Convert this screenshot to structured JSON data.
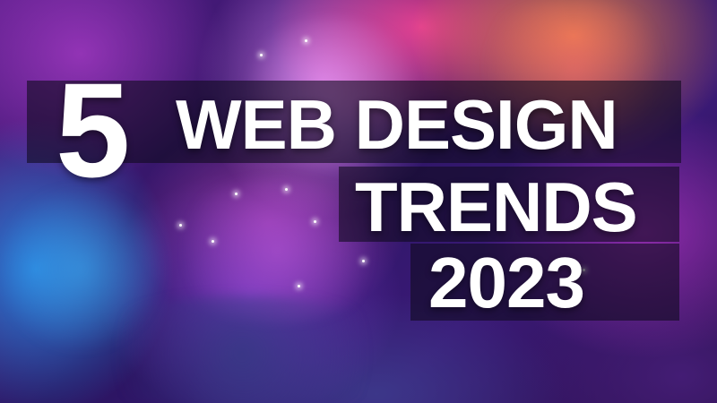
{
  "headline": {
    "number": "5",
    "line1": "WEB DESIGN",
    "line2": "TRENDS",
    "line3": "2023"
  },
  "colors": {
    "text": "#ffffff",
    "plate": "#0f0a1e",
    "nebula_pink": "#ff46a0",
    "nebula_orange": "#ff8c46",
    "nebula_blue": "#288ce6",
    "nebula_purple": "#5a1e8a"
  }
}
